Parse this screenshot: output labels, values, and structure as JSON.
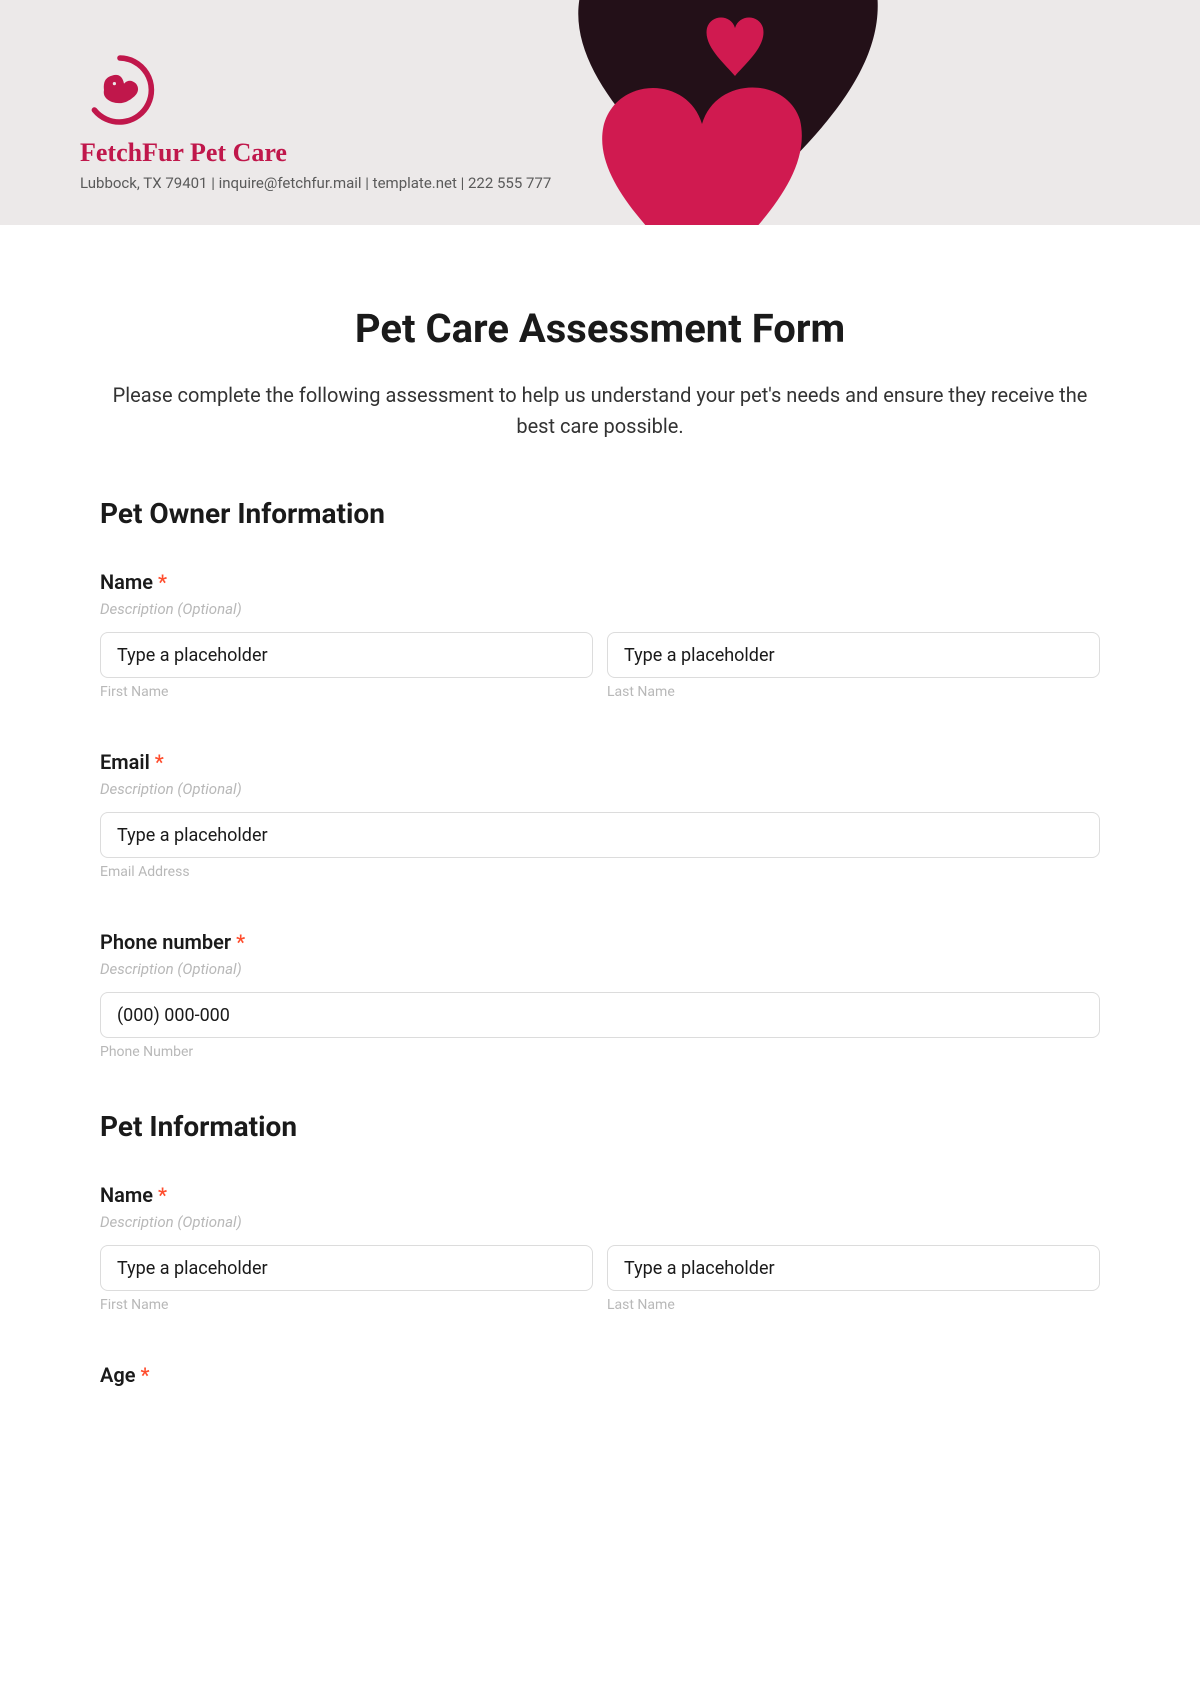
{
  "header": {
    "brand_name": "FetchFur Pet Care",
    "contact_line": "Lubbock, TX 79401 | inquire@fetchfur.mail | template.net | 222 555 777"
  },
  "form": {
    "title": "Pet Care Assessment Form",
    "intro": "Please complete the following assessment to help us understand your pet's needs and ensure they receive the best care possible."
  },
  "sections": {
    "owner": {
      "heading": "Pet Owner Information",
      "name": {
        "label": "Name",
        "required": "*",
        "desc": "Description (Optional)",
        "first_placeholder": "Type a placeholder",
        "first_sublabel": "First Name",
        "last_placeholder": "Type a placeholder",
        "last_sublabel": "Last Name"
      },
      "email": {
        "label": "Email",
        "required": "*",
        "desc": "Description (Optional)",
        "placeholder": "Type a placeholder",
        "sublabel": "Email Address"
      },
      "phone": {
        "label": "Phone number",
        "required": "*",
        "desc": "Description (Optional)",
        "placeholder": "(000) 000-000",
        "sublabel": "Phone Number"
      }
    },
    "pet": {
      "heading": "Pet Information",
      "name": {
        "label": "Name",
        "required": "*",
        "desc": "Description (Optional)",
        "first_placeholder": "Type a placeholder",
        "first_sublabel": "First Name",
        "last_placeholder": "Type a placeholder",
        "last_sublabel": "Last Name"
      },
      "age": {
        "label": "Age",
        "required": "*"
      }
    }
  },
  "colors": {
    "brand": "#c0174b",
    "header_bg": "#ece9e9",
    "heart_dark": "#231018",
    "heart_pink": "#d01a50",
    "required": "#ff4d2d"
  }
}
